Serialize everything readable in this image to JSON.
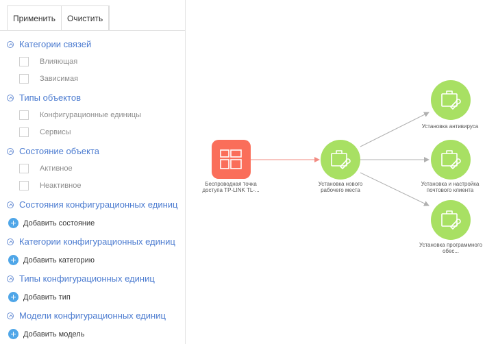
{
  "toolbar": {
    "apply_label": "Применить",
    "clear_label": "Очистить"
  },
  "sections": [
    {
      "title": "Категории связей",
      "options": [
        "Влияющая",
        "Зависимая"
      ]
    },
    {
      "title": "Типы объектов",
      "options": [
        "Конфигурационные единицы",
        "Сервисы"
      ]
    },
    {
      "title": "Состояние объекта",
      "options": [
        "Активное",
        "Неактивное"
      ]
    },
    {
      "title": "Состояния конфигурационных единиц",
      "add_label": "Добавить состояние"
    },
    {
      "title": "Категории конфигурационных единиц",
      "add_label": "Добавить категорию"
    },
    {
      "title": "Типы конфигурационных единиц",
      "add_label": "Добавить тип"
    },
    {
      "title": "Модели конфигурационных единиц",
      "add_label": "Добавить модель"
    }
  ],
  "graph": {
    "source": {
      "label": "Беспроводная точка доступа TP-LINK TL-...",
      "icon": "device-icon",
      "color": "#fa6e5a"
    },
    "center": {
      "label": "Установка нового рабочего места",
      "icon": "toolbox-icon",
      "color": "#a8e063"
    },
    "targets": [
      {
        "label": "Установка антивируса",
        "icon": "toolbox-icon"
      },
      {
        "label": "Установка и настройка почтового клиента",
        "icon": "toolbox-icon"
      },
      {
        "label": "Установка программного обес...",
        "icon": "toolbox-icon"
      }
    ],
    "edge_color_source": "#f28b82",
    "edge_color_targets": "#b0b0b0"
  }
}
